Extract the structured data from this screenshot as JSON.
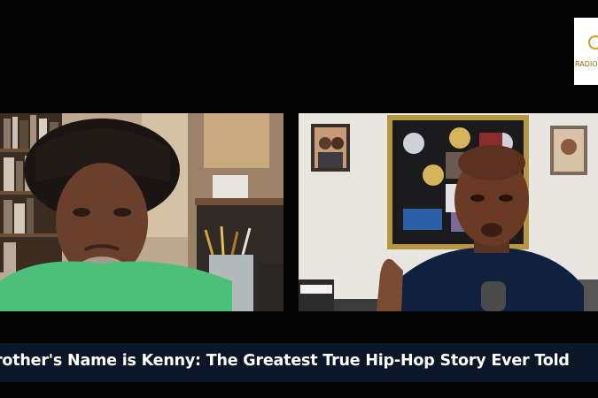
{
  "caption": {
    "title": "rother's Name is Kenny: The Greatest True Hip-Hop Story Ever Told"
  },
  "logo": {
    "text": "RADIO"
  },
  "participants": [
    {
      "tile": "left",
      "shirt_color": "#4cc07a",
      "background": "bookshelf-room"
    },
    {
      "tile": "right",
      "shirt_color": "#10213f",
      "background": "studio-wall"
    }
  ],
  "colors": {
    "page_background": "#050505",
    "caption_background": "#0b1727",
    "caption_text": "#ffffff"
  }
}
